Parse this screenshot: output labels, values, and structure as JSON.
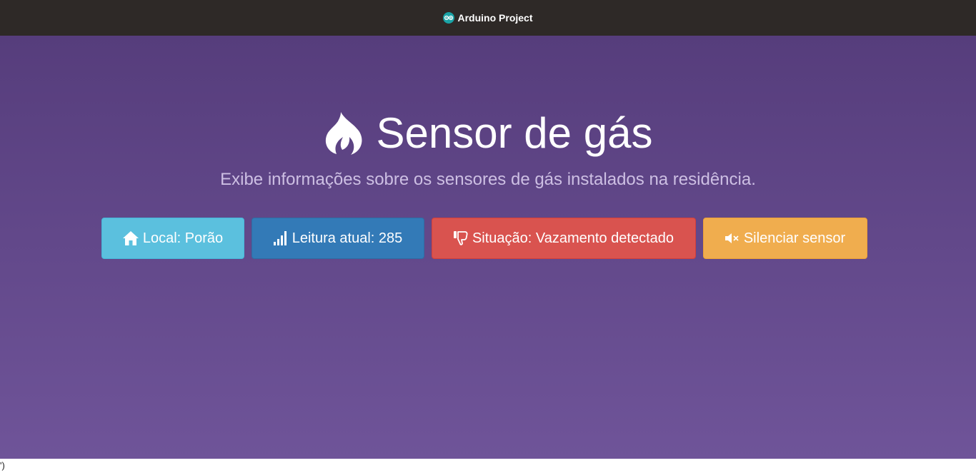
{
  "navbar": {
    "brand_label": "Arduino Project",
    "brand_icon": "arduino-logo-icon"
  },
  "hero": {
    "title": "Sensor de gás",
    "title_icon": "fire-icon",
    "subtitle": "Exibe informações sobre os sensores de gás instalados na residência."
  },
  "buttons": {
    "location": {
      "label": "Local: Porão",
      "icon": "home-icon",
      "color": "#5bc0de"
    },
    "reading": {
      "label": "Leitura atual: 285",
      "icon": "signal-bars-icon",
      "color": "#337ab7"
    },
    "status": {
      "label": "Situação: Vazamento detectado",
      "icon": "thumbs-down-icon",
      "color": "#d9534f"
    },
    "mute": {
      "label": "Silenciar sensor",
      "icon": "volume-off-icon",
      "color": "#f0ad4e"
    }
  },
  "footer": {
    "stray_text": "')"
  },
  "colors": {
    "navbar_bg": "#2e2927",
    "hero_top": "#563d7c",
    "hero_bottom": "#6f5499"
  }
}
